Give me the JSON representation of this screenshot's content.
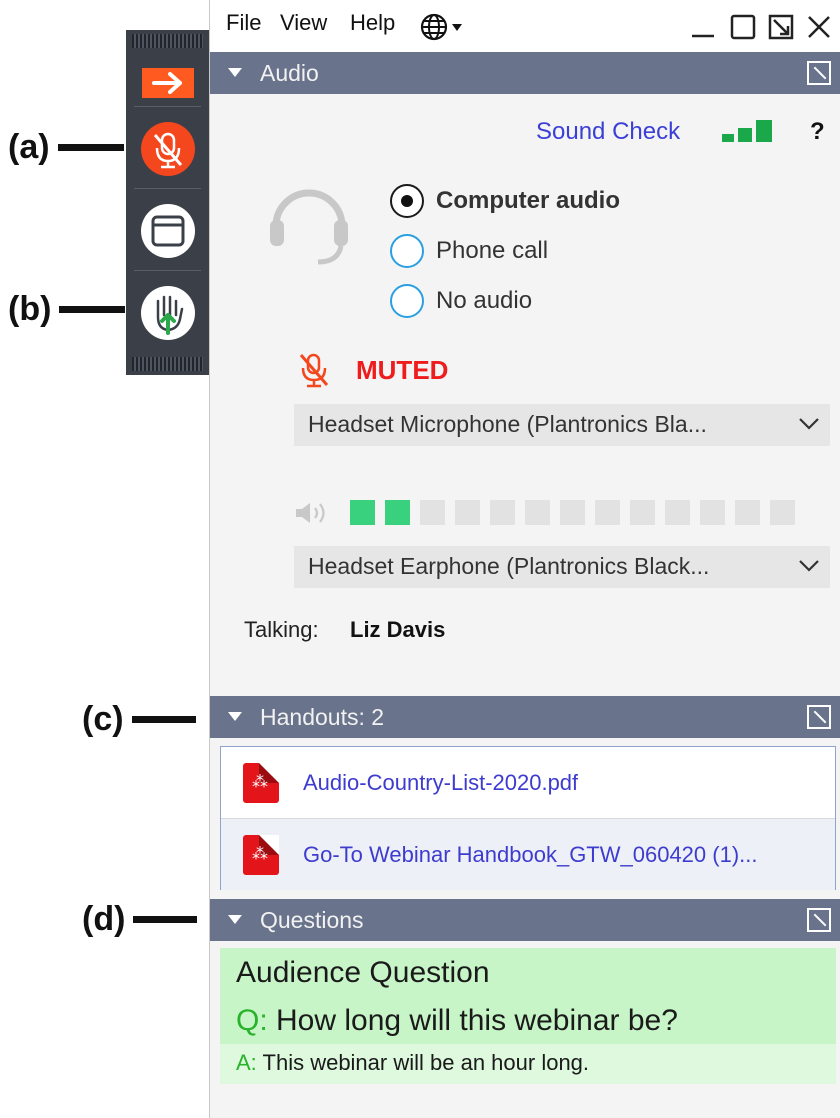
{
  "annotations": {
    "a": "(a)",
    "b": "(b)",
    "c": "(c)",
    "d": "(d)"
  },
  "control_strip": {
    "buttons": [
      "collapse-arrow",
      "microphone-muted",
      "window",
      "raise-hand"
    ],
    "colors": {
      "accent": "#ff5a1f",
      "mic_muted": "#f4471d",
      "hand_arrow": "#2aa84a"
    }
  },
  "menubar": {
    "items": [
      "File",
      "View",
      "Help"
    ],
    "language_icon": "globe-icon"
  },
  "audio": {
    "section_title": "Audio",
    "sound_check": "Sound Check",
    "help": "?",
    "options": [
      {
        "label": "Computer audio",
        "selected": true
      },
      {
        "label": "Phone call",
        "selected": false
      },
      {
        "label": "No audio",
        "selected": false
      }
    ],
    "status": "MUTED",
    "microphone_device": "Headset Microphone (Plantronics Bla...",
    "speaker_device": "Headset Earphone (Plantronics Black...",
    "volume_level": {
      "lit_segments": 2,
      "total_segments": 13
    },
    "talking_label": "Talking:",
    "talking_name": "Liz Davis"
  },
  "handouts": {
    "section_title": "Handouts: 2",
    "files": [
      "Audio-Country-List-2020.pdf",
      "Go-To Webinar Handbook_GTW_060420 (1)..."
    ]
  },
  "questions": {
    "section_title": "Questions",
    "title": "Audience Question",
    "q_prefix": "Q:",
    "question": "How long will this webinar be?",
    "a_prefix": "A:",
    "answer": "This webinar will be an hour long."
  }
}
